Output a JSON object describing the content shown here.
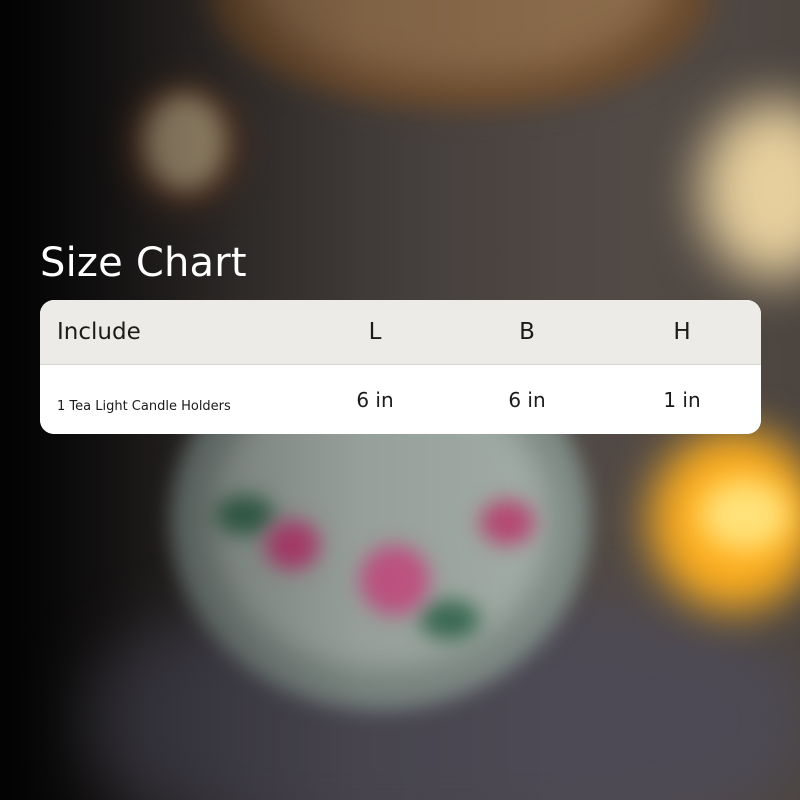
{
  "title": "Size Chart",
  "table": {
    "headers": [
      "Include",
      "L",
      "B",
      "H"
    ],
    "rows": [
      [
        "1 Tea Light Candle Holders",
        "6 in",
        "6 in",
        "1 in"
      ]
    ]
  },
  "colors": {
    "title_text": "#ffffff",
    "header_bg": "#ecebe7",
    "row_bg": "#ffffff",
    "text": "#1b1b1b"
  }
}
